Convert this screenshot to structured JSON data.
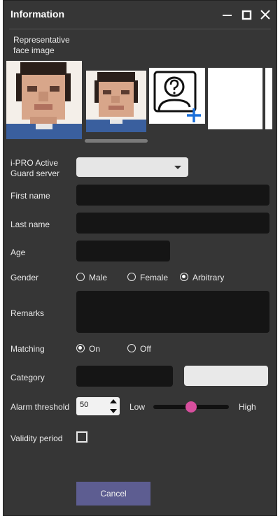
{
  "window": {
    "title": "Information"
  },
  "face": {
    "label_line1": "Representative",
    "label_line2": "face image",
    "add_icon": "add-face-icon"
  },
  "form": {
    "server_label_line1": "i-PRO Active",
    "server_label_line2": "Guard server",
    "server_value": "",
    "first_name_label": "First name",
    "first_name_value": "",
    "last_name_label": "Last name",
    "last_name_value": "",
    "age_label": "Age",
    "age_value": "",
    "gender_label": "Gender",
    "gender_options": [
      "Male",
      "Female",
      "Arbitrary"
    ],
    "gender_selected": "Arbitrary",
    "remarks_label": "Remarks",
    "remarks_value": "",
    "matching_label": "Matching",
    "matching_options": [
      "On",
      "Off"
    ],
    "matching_selected": "On",
    "category_label": "Category",
    "category_value": "",
    "alarm_label": "Alarm threshold",
    "alarm_value": "50",
    "alarm_low": "Low",
    "alarm_high": "High",
    "alarm_slider_fraction": 0.5,
    "validity_label": "Validity period",
    "validity_checked": false
  },
  "buttons": {
    "cancel": "Cancel"
  },
  "colors": {
    "background": "#363636",
    "accent": "#d84f9e",
    "button": "#5d5d91",
    "add_icon": "#1a6fd9"
  }
}
